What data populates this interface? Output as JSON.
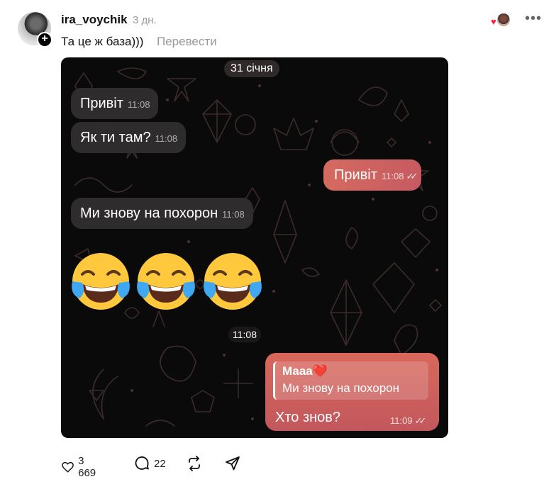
{
  "post": {
    "username": "ira_voychik",
    "time_ago": "3 дн.",
    "caption": "Та це ж база)))",
    "translate_label": "Перевести"
  },
  "chat": {
    "date": "31 січня",
    "messages": [
      {
        "dir": "in",
        "text": "Привіт",
        "time": "11:08"
      },
      {
        "dir": "in",
        "text": "Як ти там?",
        "time": "11:08"
      },
      {
        "dir": "out",
        "text": "Привіт",
        "time": "11:08"
      },
      {
        "dir": "in",
        "text": "Ми знову на похорон",
        "time": "11:08"
      }
    ],
    "emoji_message": {
      "emoji": [
        "😂",
        "😂",
        "😂"
      ],
      "time": "11:08"
    },
    "reply": {
      "quote_name": "Мааа❤️",
      "quote_text": "Ми знову на похорон",
      "text": "Хто знов?",
      "time": "11:09"
    }
  },
  "actions": {
    "likes": "3 669",
    "comments": "22"
  },
  "icons": [
    "heart-icon",
    "comment-icon",
    "repost-icon",
    "share-icon",
    "more-icon",
    "read-ticks-icon"
  ],
  "colors": {
    "outgoing_bubble": "#d0625f",
    "incoming_bubble": "#302e2e",
    "chat_background": "#0b0a0a",
    "heart": "#ff2244"
  }
}
